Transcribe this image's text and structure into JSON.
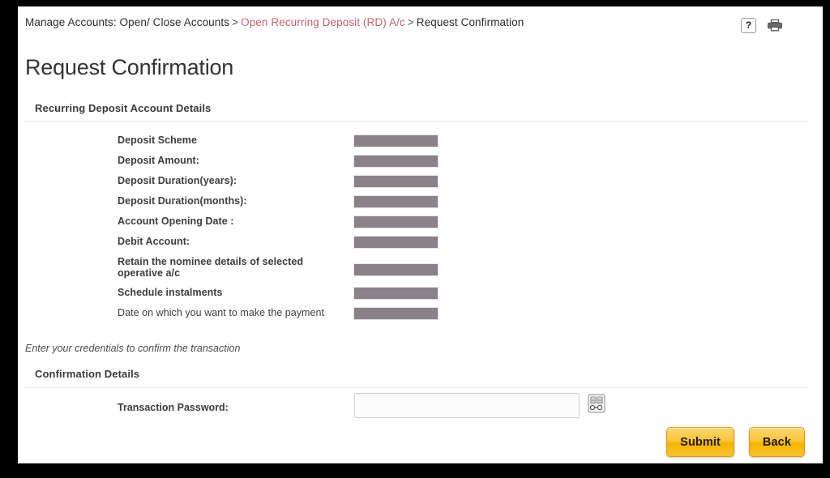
{
  "breadcrumb": {
    "static_prefix": "Manage Accounts: Open/ Close Accounts",
    "separator_1": ">",
    "link": "Open Recurring Deposit (RD) A/c",
    "separator_2": ">",
    "current": "Request Confirmation"
  },
  "top_icons": {
    "help_label": "?",
    "help_name": "help-icon",
    "print_name": "print-icon"
  },
  "page_title": "Request Confirmation",
  "details_section": {
    "heading": "Recurring Deposit Account Details",
    "rows": [
      {
        "label": "Deposit Scheme",
        "value": "",
        "redacted": true,
        "weight": "bold"
      },
      {
        "label": "Deposit Amount:",
        "value": "",
        "redacted": true,
        "weight": "bold"
      },
      {
        "label": "Deposit Duration(years):",
        "value": "",
        "redacted": true,
        "weight": "bold"
      },
      {
        "label": "Deposit Duration(months):",
        "value": "",
        "redacted": true,
        "weight": "bold"
      },
      {
        "label": "Account Opening Date :",
        "value": "",
        "redacted": true,
        "weight": "bold"
      },
      {
        "label": "Debit Account:",
        "value": "",
        "redacted": true,
        "weight": "bold"
      },
      {
        "label": "Retain the nominee details of selected operative a/c",
        "value": "",
        "redacted": true,
        "weight": "bold"
      },
      {
        "label": "Schedule instalments",
        "value": "",
        "redacted": true,
        "weight": "bold"
      },
      {
        "label": "Date on which you want to make the payment",
        "value": "",
        "redacted": true,
        "weight": "normal"
      }
    ]
  },
  "credentials_note": "Enter your credentials to confirm the transaction",
  "confirmation_section": {
    "heading": "Confirmation Details",
    "password_label": "Transaction Password:",
    "password_value": "",
    "password_placeholder": "",
    "virtual_keyboard_name": "virtual-keyboard-icon"
  },
  "buttons": {
    "submit": "Submit",
    "back": "Back"
  },
  "colors": {
    "link": "#c8606f",
    "redaction_bar": "#8a8189",
    "button_gold": "#f5b400",
    "frame": "#000000",
    "rule": "#e8e8ea"
  }
}
